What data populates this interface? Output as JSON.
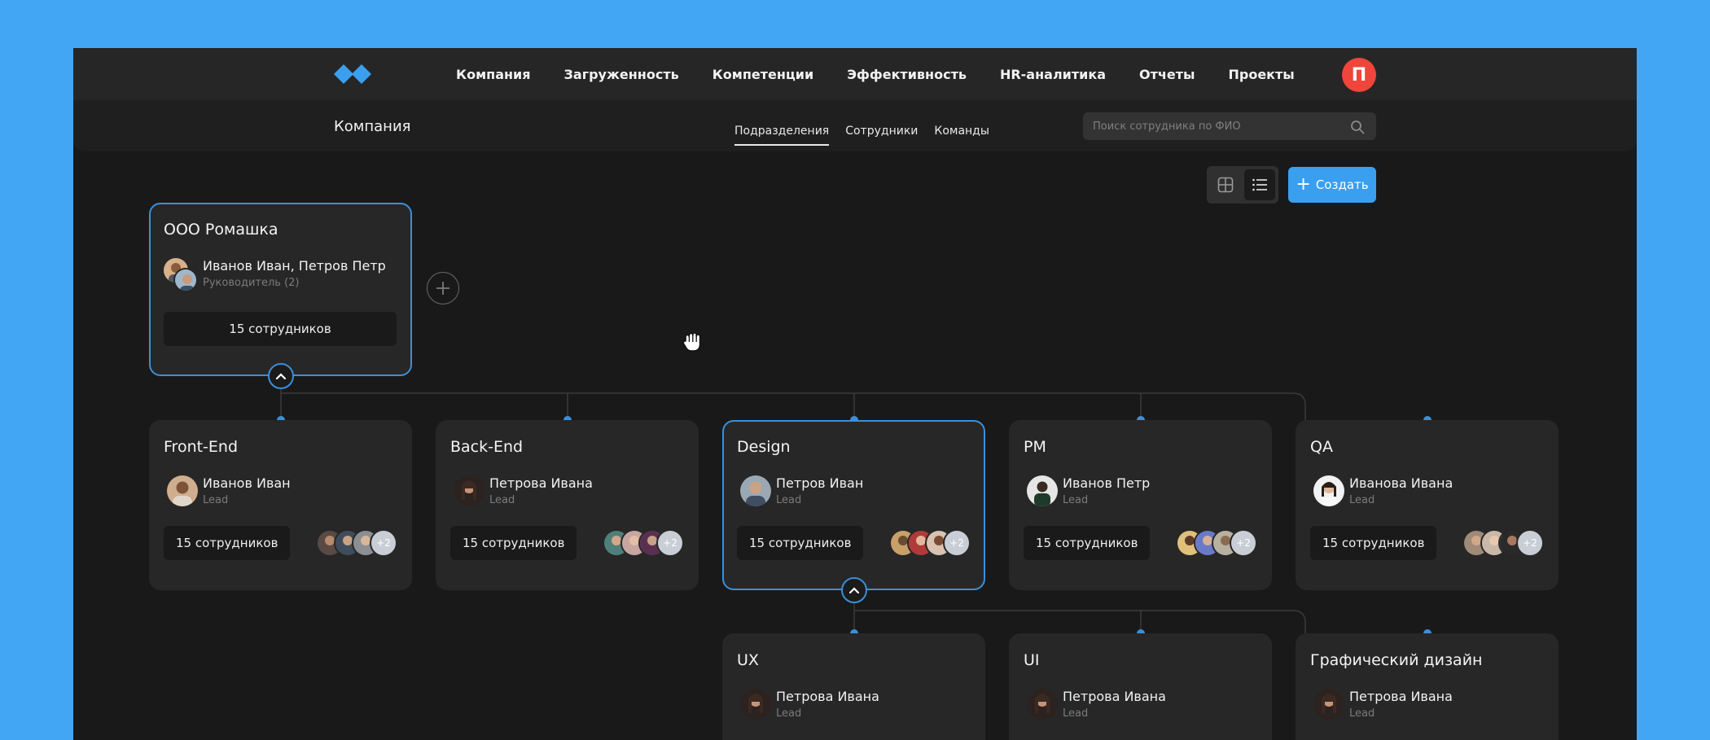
{
  "nav": {
    "items": [
      "Компания",
      "Загруженность",
      "Компетенции",
      "Эффективность",
      "HR-аналитика",
      "Отчеты",
      "Проекты"
    ],
    "user_initial": "П",
    "brand_color": "#3b9ff0",
    "avatar_color": "#f0453a"
  },
  "page": {
    "title": "Компания",
    "tabs": [
      "Подразделения",
      "Сотрудники",
      "Команды"
    ],
    "active_tab": "Подразделения",
    "search_placeholder": "Поиск сотрудника по ФИО"
  },
  "toolbar": {
    "active_view": "list",
    "create_label": "Создать"
  },
  "root": {
    "title": "ООО Ромашка",
    "leads": "Иванов Иван, Петров Петр",
    "role": "Руководитель (2)",
    "count": "15 сотрудников"
  },
  "departments": [
    {
      "title": "Front-End",
      "lead": "Иванов Иван",
      "role": "Lead",
      "count": "15 сотрудников",
      "more": "+2"
    },
    {
      "title": "Back-End",
      "lead": "Петрова Ивана",
      "role": "Lead",
      "count": "15 сотрудников",
      "more": "+2"
    },
    {
      "title": "Design",
      "lead": "Петров Иван",
      "role": "Lead",
      "count": "15 сотрудников",
      "more": "+2"
    },
    {
      "title": "PM",
      "lead": "Иванов Петр",
      "role": "Lead",
      "count": "15 сотрудников",
      "more": "+2"
    },
    {
      "title": "QA",
      "lead": "Иванова Ивана",
      "role": "Lead",
      "count": "15 сотрудников",
      "more": "+2"
    }
  ],
  "design_subdepartments": [
    {
      "title": "UX",
      "lead": "Петрова Ивана",
      "role": "Lead"
    },
    {
      "title": "UI",
      "lead": "Петрова Ивана",
      "role": "Lead"
    },
    {
      "title": "Графический дизайн",
      "lead": "Петрова Ивана",
      "role": "Lead"
    }
  ]
}
